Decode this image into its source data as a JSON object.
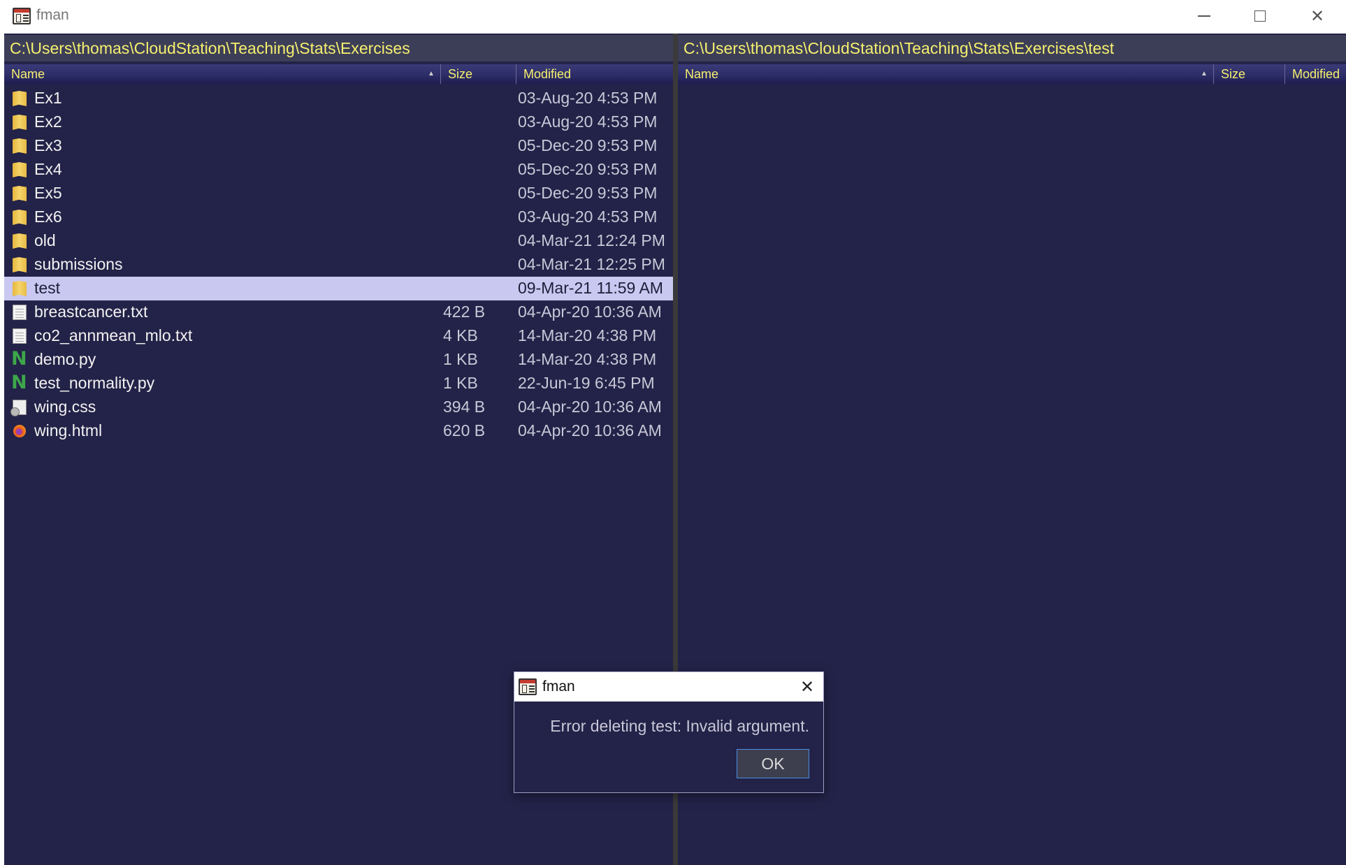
{
  "window": {
    "title": "fman",
    "controls": [
      "minimize-icon",
      "maximize-icon",
      "close-icon"
    ],
    "close_glyph": "✕"
  },
  "left_pane": {
    "path": "C:\\Users\\thomas\\CloudStation\\Teaching\\Stats\\Exercises",
    "columns": {
      "name": "Name",
      "size": "Size",
      "modified": "Modified"
    },
    "sort_indicator": "▲",
    "files": [
      {
        "name": "Ex1",
        "size": "",
        "modified": "03-Aug-20 4:53 PM",
        "icon": "folder-icon"
      },
      {
        "name": "Ex2",
        "size": "",
        "modified": "03-Aug-20 4:53 PM",
        "icon": "folder-icon"
      },
      {
        "name": "Ex3",
        "size": "",
        "modified": "05-Dec-20 9:53 PM",
        "icon": "folder-icon"
      },
      {
        "name": "Ex4",
        "size": "",
        "modified": "05-Dec-20 9:53 PM",
        "icon": "folder-icon"
      },
      {
        "name": "Ex5",
        "size": "",
        "modified": "05-Dec-20 9:53 PM",
        "icon": "folder-icon"
      },
      {
        "name": "Ex6",
        "size": "",
        "modified": "03-Aug-20 4:53 PM",
        "icon": "folder-icon"
      },
      {
        "name": "old",
        "size": "",
        "modified": "04-Mar-21 12:24 PM",
        "icon": "folder-icon"
      },
      {
        "name": "submissions",
        "size": "",
        "modified": "04-Mar-21 12:25 PM",
        "icon": "folder-icon"
      },
      {
        "name": "test",
        "size": "",
        "modified": "09-Mar-21 11:59 AM",
        "icon": "folder-icon",
        "selected": true
      },
      {
        "name": "breastcancer.txt",
        "size": "422 B",
        "modified": "04-Apr-20 10:36 AM",
        "icon": "text-file-icon"
      },
      {
        "name": "co2_annmean_mlo.txt",
        "size": "4 KB",
        "modified": "14-Mar-20 4:38 PM",
        "icon": "text-file-icon"
      },
      {
        "name": "demo.py",
        "size": "1 KB",
        "modified": "14-Mar-20 4:38 PM",
        "icon": "python-file-icon"
      },
      {
        "name": "test_normality.py",
        "size": "1 KB",
        "modified": "22-Jun-19 6:45 PM",
        "icon": "python-file-icon"
      },
      {
        "name": "wing.css",
        "size": "394 B",
        "modified": "04-Apr-20 10:36 AM",
        "icon": "css-file-icon"
      },
      {
        "name": "wing.html",
        "size": "620 B",
        "modified": "04-Apr-20 10:36 AM",
        "icon": "html-file-icon"
      }
    ]
  },
  "right_pane": {
    "path": "C:\\Users\\thomas\\CloudStation\\Teaching\\Stats\\Exercises\\test",
    "columns": {
      "name": "Name",
      "size": "Size",
      "modified": "Modified"
    },
    "sort_indicator": "▲",
    "files": []
  },
  "dialog": {
    "title": "fman",
    "message": "Error deleting test: Invalid argument.",
    "ok_label": "OK",
    "close_glyph": "✕"
  },
  "colors": {
    "background": "#232248",
    "path_text": "#f6f06e",
    "selection": "#c9c8f0",
    "ok_focus_border": "#4f8de0"
  }
}
